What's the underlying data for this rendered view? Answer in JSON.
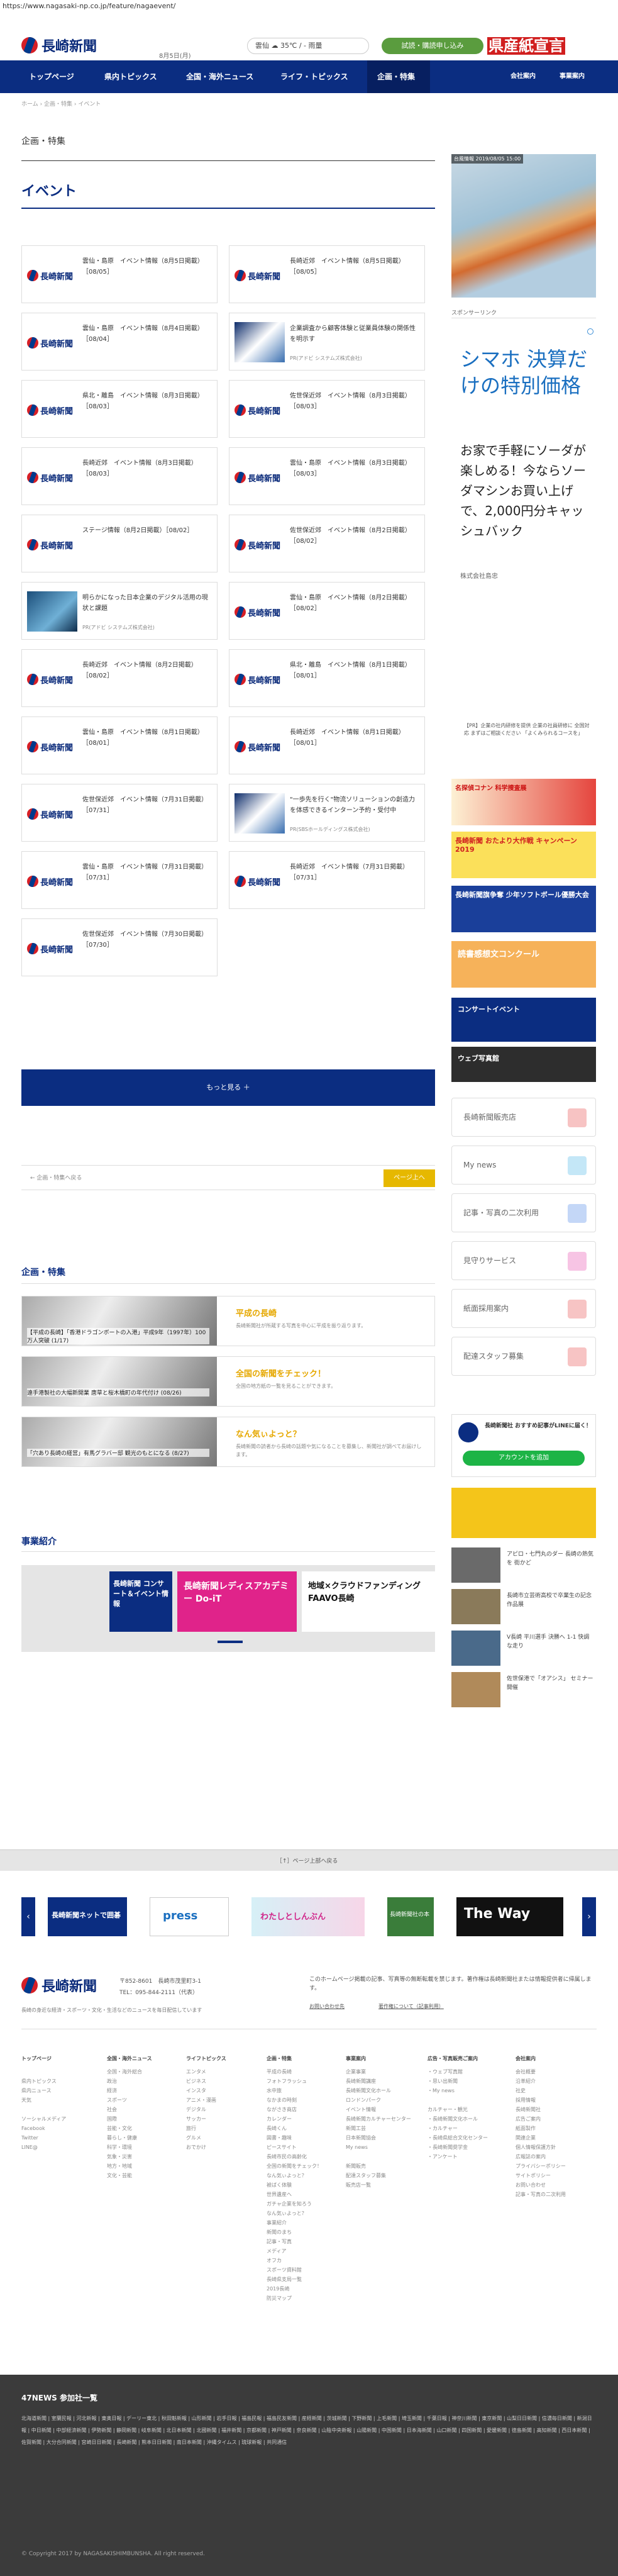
{
  "browser": {
    "url": "https://www.nagasaki-np.co.jp/feature/nagaevent/"
  },
  "header": {
    "logo_text": "長崎新聞",
    "date": "8月5日(月)",
    "weather": "雲仙 ☁ 35℃ / - 雨量",
    "trial_button": "試読・購読申し込み",
    "ad": "県産紙宣言"
  },
  "nav": {
    "items": [
      "トップページ",
      "県内トピックス",
      "全国・海外ニュース",
      "ライフ・トピックス",
      "企画・特集"
    ],
    "sub": [
      "会社案内",
      "事業案内"
    ]
  },
  "breadcrumb": "ホーム › 企画・特集 › イベント",
  "page": {
    "label": "企画・特集",
    "title": "イベント"
  },
  "cards": [
    {
      "title": "雲仙・島原　イベント情報（8月5日掲載）［08/05］",
      "thumb": "logo",
      "src": ""
    },
    {
      "title": "長崎近郊　イベント情報（8月5日掲載）［08/05］",
      "thumb": "logo",
      "src": ""
    },
    {
      "title": "雲仙・島原　イベント情報（8月4日掲載）［08/04］",
      "thumb": "logo",
      "src": ""
    },
    {
      "title": "企業調査から顧客体験と従業員体験の関係性を明示す",
      "thumb": "photo2",
      "src": "PR(アドビ システムズ株式会社)"
    },
    {
      "title": "県北・離島　イベント情報（8月3日掲載）［08/03］",
      "thumb": "logo",
      "src": ""
    },
    {
      "title": "佐世保近郊　イベント情報（8月3日掲載）［08/03］",
      "thumb": "logo",
      "src": ""
    },
    {
      "title": "長崎近郊　イベント情報（8月3日掲載）［08/03］",
      "thumb": "logo",
      "src": ""
    },
    {
      "title": "雲仙・島原　イベント情報（8月3日掲載）［08/03］",
      "thumb": "logo",
      "src": ""
    },
    {
      "title": "ステージ情報（8月2日掲載）［08/02］",
      "thumb": "logo",
      "src": ""
    },
    {
      "title": "佐世保近郊　イベント情報（8月2日掲載）［08/02］",
      "thumb": "logo",
      "src": ""
    },
    {
      "title": "明らかになった日本企業のデジタル活用の現状と課題",
      "thumb": "photo",
      "src": "PR(アドビ システムズ株式会社)"
    },
    {
      "title": "雲仙・島原　イベント情報（8月2日掲載）［08/02］",
      "thumb": "logo",
      "src": ""
    },
    {
      "title": "長崎近郊　イベント情報（8月2日掲載）［08/02］",
      "thumb": "logo",
      "src": ""
    },
    {
      "title": "県北・離島　イベント情報（8月1日掲載）［08/01］",
      "thumb": "logo",
      "src": ""
    },
    {
      "title": "雲仙・島原　イベント情報（8月1日掲載）［08/01］",
      "thumb": "logo",
      "src": ""
    },
    {
      "title": "長崎近郊　イベント情報（8月1日掲載）［08/01］",
      "thumb": "logo",
      "src": ""
    },
    {
      "title": "佐世保近郊　イベント情報（7月31日掲載）［07/31］",
      "thumb": "logo",
      "src": ""
    },
    {
      "title": "\"一歩先を行く\"物流ソリューションの創造力を体感できるインターン予約・受付中",
      "thumb": "photo2",
      "src": "PR(SBSホールディングス株式会社)"
    },
    {
      "title": "雲仙・島原　イベント情報（7月31日掲載）［07/31］",
      "thumb": "logo",
      "src": ""
    },
    {
      "title": "長崎近郊　イベント情報（7月31日掲載）［07/31］",
      "thumb": "logo",
      "src": ""
    },
    {
      "title": "佐世保近郊　イベント情報（7月30日掲載）［07/30］",
      "thumb": "logo",
      "src": ""
    }
  ],
  "more_button": "もっと見る ＋",
  "pager": {
    "back": "← 企画・特集へ戻る",
    "top": "ページ上へ"
  },
  "feature_section": {
    "title": "企画・特集",
    "items": [
      {
        "caption": "【平成の長崎】「香港ドラゴンボートの入港」平成9年（1997年）100万人突破 (1/17)",
        "title": "平成の長崎",
        "desc": "長崎新聞社が所蔵する写真を中心に平成を振り返ります。"
      },
      {
        "caption": "遠手港製社の大幅新開業 唐草と桜木橋町の年代付け (08/26)",
        "title": "全国の新聞をチェック！",
        "desc": "全国の地方紙の一覧を見ることができます。"
      },
      {
        "caption": "「穴あり長崎の経営」有馬グラバー邸 観光のもとになる (8/27)",
        "title": "なん気ぃよっと？",
        "desc": "長崎新聞の読者から長崎の話題や気になることを募集し、新聞社が調べてお届けします。"
      }
    ]
  },
  "business_section": {
    "title": "事業紹介",
    "cards": [
      {
        "label": "長崎新聞 コンサート＆イベント情報"
      },
      {
        "label": "長崎新聞レディスアカデミー Do-iT"
      },
      {
        "label": "地域×クラウドファンディング FAAVO長崎"
      }
    ]
  },
  "sidebar": {
    "weather_label": "台風情報 2019/08/05 15:00",
    "sponsored": "スポンサーリンク",
    "ad_headline": "シマホ 決算だけの特別価格",
    "ad_body": "お家で手軽にソーダが楽しめる！今ならソーダマシンお買い上げで、2,000円分キャッシュバック",
    "ad_company": "株式会社島忠",
    "ad_small": "【PR】企業の社内研修を提供 企業の社員研修に 全国対応 まずはご相談ください 「よくみられるコースを」",
    "banners": [
      "名探偵コナン 科学捜査展",
      "長崎新聞 おたより大作戦 キャンペーン2019",
      "長崎新聞旗争奪 少年ソフトボール優勝大会",
      "読書感想文コンクール",
      "コンサートイベント",
      "ウェブ写真館"
    ],
    "links": [
      "長崎新聞販売店",
      "My news",
      "記事・写真の二次利用",
      "見守りサービス",
      "紙面採用案内",
      "配達スタッフ募集"
    ],
    "friends": "長崎新聞社 おすすめ記事がLINEに届く！",
    "line_button": "アカウントを追加",
    "ranking": [
      {
        "text": "アピロ・七門丸のダー 長崎の熱気を 街かど"
      },
      {
        "text": "長崎市立芸術高校で卒業生の記念作品展"
      },
      {
        "text": "V長崎 平川選手 決勝へ 1-1 快調な走り"
      },
      {
        "text": "佐世保港で「オアシス」 セミナー 開催"
      }
    ]
  },
  "page_top_bar": "［↑］ページ上部へ戻る",
  "bottom_banners": [
    "長崎新聞ネットで囲碁",
    "press",
    "わたしとしんぶん",
    "長崎新聞社の本",
    "The Way"
  ],
  "footer": {
    "address": "〒852-8601　長崎市茂里町3-1",
    "tel": "TEL：095-844-2111（代表）",
    "tagline": "長崎の身近な経済・スポーツ・文化・生活などのニュースを毎日配信しています",
    "notice": "このホームページ掲載の記事、写真等の無断転載を禁じます。著作権は長崎新聞社または情報提供者に帰属します。",
    "links": [
      "お問い合わせ先",
      "著作権について（記事利用）"
    ],
    "columns": [
      {
        "head": "トップページ",
        "items": [
          "",
          "県内トピックス",
          "県内ニュース",
          "天気",
          "",
          "ソーシャルメディア",
          "Facebook",
          "Twitter",
          "LINE@"
        ]
      },
      {
        "head": "全国・海外ニュース",
        "items": [
          "全国・海外総合",
          "政治",
          "経済",
          "スポーツ",
          "社会",
          "国際",
          "芸能・文化",
          "暮らし・健康",
          "科学・環境",
          "気象・災害",
          "地方・地域",
          "文化・芸能"
        ]
      },
      {
        "head": "ライフトピックス",
        "items": [
          "エンタメ",
          "ビジネス",
          "インスタ",
          "アニメ・漫画",
          "デジタル",
          "サッカー",
          "旅行",
          "グルメ",
          "おでかけ"
        ]
      },
      {
        "head": "企画・特集",
        "items": [
          "平成の長崎",
          "フォトフラッシュ",
          "水中旅",
          "なかまの時刻",
          "ながさき商店",
          "カレンダー",
          "長崎くん",
          "図書・趣味",
          "ピースサイト",
          "長崎市民の高齢化",
          "全国の新聞をチェック！",
          "なん気ぃよっと？",
          "被ばく体験",
          "世界遺産へ",
          "ガチャ企業を知ろう",
          "なん気ぃよっと？",
          "事業紹介",
          "新聞のまち",
          "記事・写真",
          "メディア",
          "オフカ",
          "スポーツ資料館",
          "長崎県支局一覧",
          "2019長崎",
          "防災マップ"
        ]
      },
      {
        "head": "事業案内",
        "items": [
          "企業事業",
          "長崎新聞講座",
          "長崎新聞文化ホール",
          "ロンドンパーク",
          "イベント情報",
          "長崎新聞カルチャーセンター",
          "新聞工芸",
          "日本新聞協会",
          "My news",
          "",
          "新聞販売",
          "配達スタッフ募集",
          "販売店一覧"
        ]
      },
      {
        "head": "広告・写真販売ご案内",
        "items": [
          "・ウェブ写真館",
          "・思い出新聞",
          "・My news",
          "",
          "カルチャー・観光",
          "・長崎新聞文化ホール",
          "・カルチャー",
          "・長崎県総合文化センター",
          "・長崎新聞奨学金",
          "・アンケート"
        ]
      },
      {
        "head": "会社案内",
        "items": [
          "会社概要",
          "沿革紹介",
          "社史",
          "採用情報",
          "長崎新聞社",
          "広告ご案内",
          "紙面製作",
          "関連企業",
          "個人情報保護方針",
          "広報誌の案内",
          "プライバシーポリシー",
          "サイトポリシー",
          "お問い合わせ",
          "記事・写真の二次利用"
        ]
      }
    ]
  },
  "bottom": {
    "title": "47NEWS 参加社一覧",
    "links": "北海道新聞 | 室蘭民報 | 河北新報 | 東奥日報 | デーリー東北 | 秋田魁新報 | 山形新聞 | 岩手日報 | 福島民報 | 福島民友新聞 | 産経新聞 | 茨城新聞 | 下野新聞 | 上毛新聞 | 埼玉新聞 | 千葉日報 | 神奈川新聞 | 東京新聞 | 山梨日日新聞 | 信濃毎日新聞 | 新潟日報 | 中日新聞 | 中部経済新聞 | 伊勢新聞 | 静岡新聞 | 岐阜新聞 | 北日本新聞 | 北國新聞 | 福井新聞 | 京都新聞 | 神戸新聞 | 奈良新聞 | 山陰中央新報 | 山陽新聞 | 中国新聞 | 日本海新聞 | 山口新聞 | 四国新聞 | 愛媛新聞 | 徳島新聞 | 高知新聞 | 西日本新聞 | 佐賀新聞 | 大分合同新聞 | 宮崎日日新聞 | 長崎新聞 | 熊本日日新聞 | 南日本新聞 | 沖縄タイムス | 琉球新報 | 共同通信",
    "copyright": "© Copyright 2017 by NAGASAKISHIMBUNSHA. All right reserved."
  }
}
